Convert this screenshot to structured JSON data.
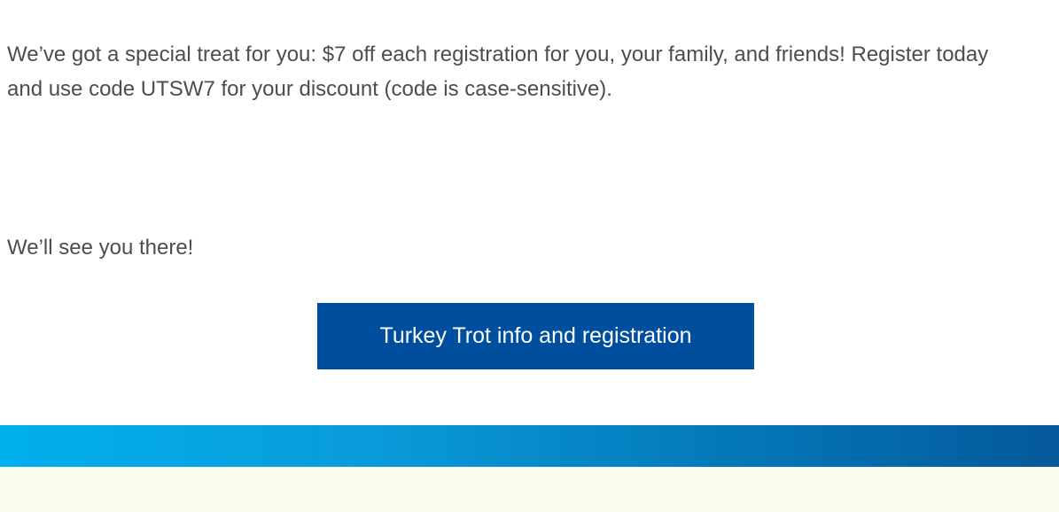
{
  "email": {
    "paragraphs": [
      "We’ve got a special treat for you: $7 off each registration for you, your family, and friends!  Register today and use code UTSW7 for your discount (code is case-sensitive).",
      "We’ll see you there!"
    ],
    "cta_label": "Turkey Trot info and registration"
  },
  "colors": {
    "cta_background": "#004f9e",
    "cta_text": "#ffffff",
    "gradient_start": "#00b0ed",
    "gradient_end": "#04599a",
    "footer_background": "#f9fced",
    "body_text": "#4d4d4d"
  }
}
